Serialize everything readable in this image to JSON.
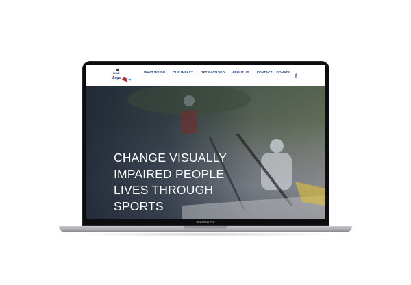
{
  "device": {
    "label": "MacBook Pro"
  },
  "site": {
    "nav": [
      {
        "label": "WHAT WE DO",
        "has_dropdown": true
      },
      {
        "label": "OUR IMPACT",
        "has_dropdown": true
      },
      {
        "label": "GET INVOLVED",
        "has_dropdown": true
      },
      {
        "label": "ABOUT US",
        "has_dropdown": true
      },
      {
        "label": "CONTACT",
        "has_dropdown": false
      },
      {
        "label": "DONATE",
        "has_dropdown": false
      }
    ],
    "social_icon": "facebook-icon",
    "hero": {
      "title_lines": [
        "CHANGE VISUALLY",
        "IMPAIRED PEOPLE",
        "LIVES THROUGH",
        "SPORTS"
      ]
    }
  },
  "colors": {
    "nav_text": "#1e3a7a",
    "facebook": "#3b5998",
    "hero_text": "#ffffff",
    "laptop_bezel": "#0d0d0f"
  }
}
